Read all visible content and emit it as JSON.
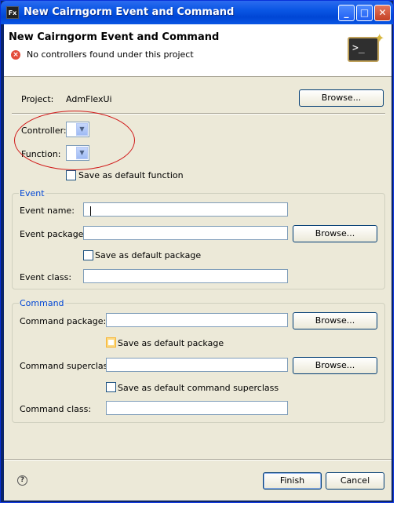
{
  "window": {
    "title": "New Cairngorm Event and Command",
    "app_icon": "Fx",
    "controls": {
      "minimize": "_",
      "maximize": "□",
      "close": "✕"
    }
  },
  "banner": {
    "title": "New Cairngorm Event and Command",
    "message": "No controllers found under this project",
    "error_icon": "error-icon",
    "wizard_image": "terminal-wizard-icon"
  },
  "project": {
    "label": "Project:",
    "value": "AdmFlexUi",
    "browse": "Browse..."
  },
  "controller": {
    "label": "Controller:",
    "value": ""
  },
  "function": {
    "label": "Function:",
    "value": "",
    "save_default": "Save as default function"
  },
  "event": {
    "group_title": "Event",
    "name_label": "Event name:",
    "name_value": "",
    "package_label": "Event package:",
    "package_value": "",
    "package_browse": "Browse...",
    "save_default_package": "Save as default package",
    "class_label": "Event class:",
    "class_value": ""
  },
  "command": {
    "group_title": "Command",
    "package_label": "Command package:",
    "package_value": "",
    "package_browse": "Browse...",
    "save_default_package": "Save as default package",
    "superclass_label": "Command superclass:",
    "superclass_value": "",
    "superclass_browse": "Browse...",
    "save_default_superclass": "Save as default command superclass",
    "class_label": "Command class:",
    "class_value": ""
  },
  "footer": {
    "help": "?",
    "finish": "Finish",
    "cancel": "Cancel"
  }
}
